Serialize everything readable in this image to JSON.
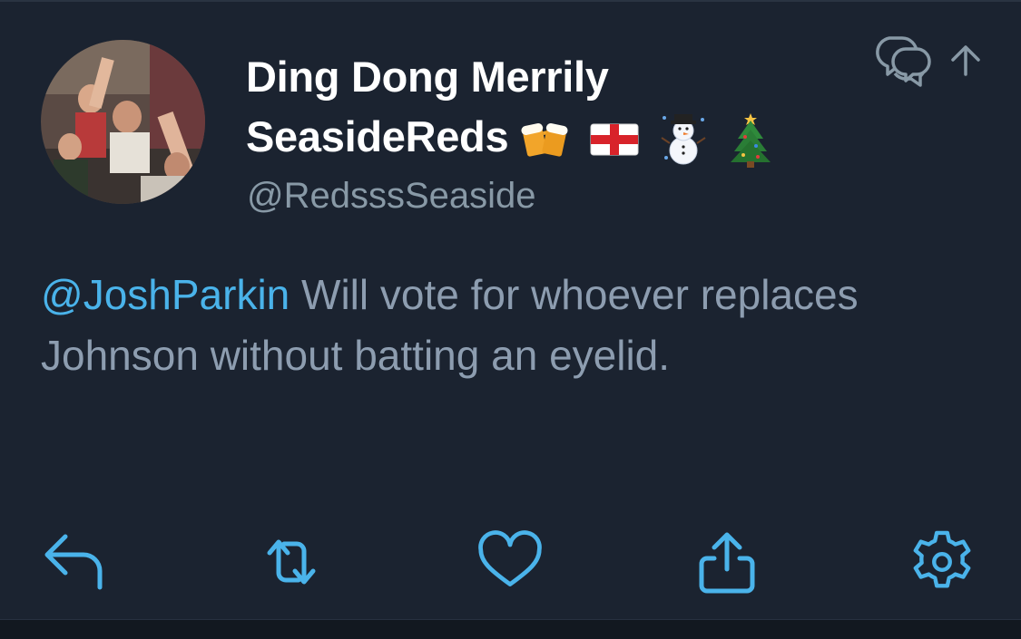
{
  "tweet": {
    "author": {
      "display_name_line1": "Ding Dong Merrily",
      "display_name_line2": "SeasideReds",
      "emojis": [
        "beer-mugs-emoji",
        "england-flag-emoji",
        "snowman-emoji",
        "christmas-tree-emoji"
      ],
      "handle": "@RedsssSeaside"
    },
    "mention": "@JoshParkin",
    "text": " Will vote for whoever replaces Johnson without batting an eyelid."
  },
  "header_actions": [
    {
      "icon": "conversation-icon"
    },
    {
      "icon": "share-arrow-up-icon"
    }
  ],
  "actions": [
    {
      "icon": "reply-icon"
    },
    {
      "icon": "retweet-icon"
    },
    {
      "icon": "like-heart-icon"
    },
    {
      "icon": "share-icon"
    },
    {
      "icon": "settings-gear-icon"
    }
  ],
  "colors": {
    "background": "#1b2330",
    "accent": "#4ab3ea",
    "text_secondary": "#8d9db0",
    "handle": "#8899a6",
    "icon_muted": "#8899a6"
  }
}
